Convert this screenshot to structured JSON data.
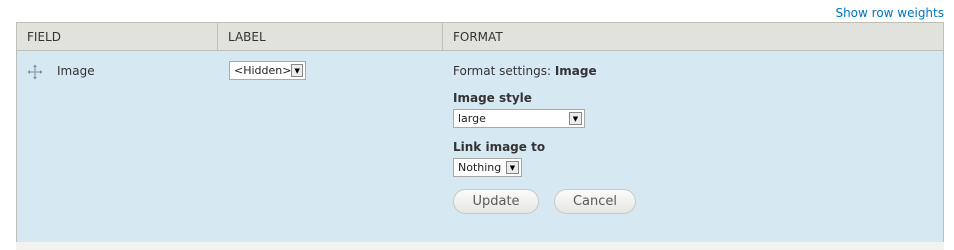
{
  "header": {
    "show_row_weights": "Show row weights"
  },
  "table": {
    "columns": [
      "FIELD",
      "LABEL",
      "FORMAT"
    ],
    "row": {
      "field_name": "Image",
      "label_select": "<Hidden>",
      "format": {
        "settings_prefix": "Format settings:",
        "settings_name": "Image",
        "image_style_label": "Image style",
        "image_style_value": "large",
        "link_label": "Link image to",
        "link_value": "Nothing",
        "update_button": "Update",
        "cancel_button": "Cancel"
      }
    }
  },
  "colors": {
    "row_bg": "#d6e9f3",
    "header_bg": "#e1e2dc",
    "link": "#0074bd"
  },
  "icons": {
    "drag": "drag-handle-icon",
    "select_arrow": "chevron-down-icon"
  }
}
